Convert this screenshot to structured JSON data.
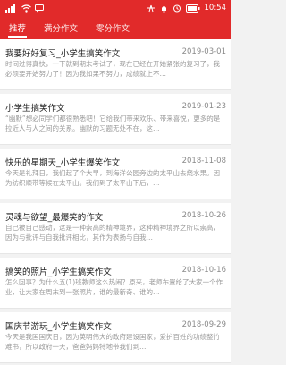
{
  "status_bar": {
    "time": "10:54",
    "battery_level": "100%",
    "signal_icon": "signal-icon",
    "wifi_icon": "wifi-icon",
    "notification_icon": "huawei-icon",
    "bell_icon": "bell-icon",
    "alarm_icon": "alarm-icon",
    "battery_icon": "battery-icon"
  },
  "tabs": [
    {
      "label": "推荐",
      "active": true
    },
    {
      "label": "满分作文",
      "active": false
    },
    {
      "label": "零分作文",
      "active": false
    }
  ],
  "articles": [
    {
      "title": "我要好好复习_小学生搞笑作文",
      "date": "2019-03-01",
      "summary": "时间过得真快，一下就到期末考试了，现在已经在开始紧张的复习了，我必须要开始努力了！因为我如果不努力，成绩就上不…"
    },
    {
      "title": "小学生搞笑作文",
      "date": "2019-01-23",
      "summary": "“幽默”想必同学们都很熟悉吧！它给我们带来欢乐、带来喜悦，更多的是拉近人与人之间的关系。幽默的习题无处不在，这…"
    },
    {
      "title": "快乐的星期天_小学生爆笑作文",
      "date": "2018-11-08",
      "summary": "今天是礼拜日，我们起了个大早，到海洋公园旁边的太平山去烧水果。因为纺织顺带等候在太平山。我们到了太平山下后，…"
    },
    {
      "title": "灵魂与欲望_最爆笑的作文",
      "date": "2018-10-26",
      "summary": "自己被自己感动，这是一种崇高的精神境界，这种精神境界之所以崇高，因为与批评与自我批评相比，其作为表扬与自我…"
    },
    {
      "title": "搞笑的照片_小学生搞笑作文",
      "date": "2018-10-16",
      "summary": "怎么回事？为什么五(1)班教师这么热闹？原来，老师布置给了大家一个作业，让大家在周末到一张照片，谁的最新奇、谁的…"
    },
    {
      "title": "国庆节游玩_小学生搞笑作文",
      "date": "2018-09-29",
      "summary": "今天是我国国庆日，因为英明伟大的政府建设国家，爱护百姓的功绩整竹难书，所以政府一天，爸爸妈妈特地带我们到…"
    }
  ]
}
